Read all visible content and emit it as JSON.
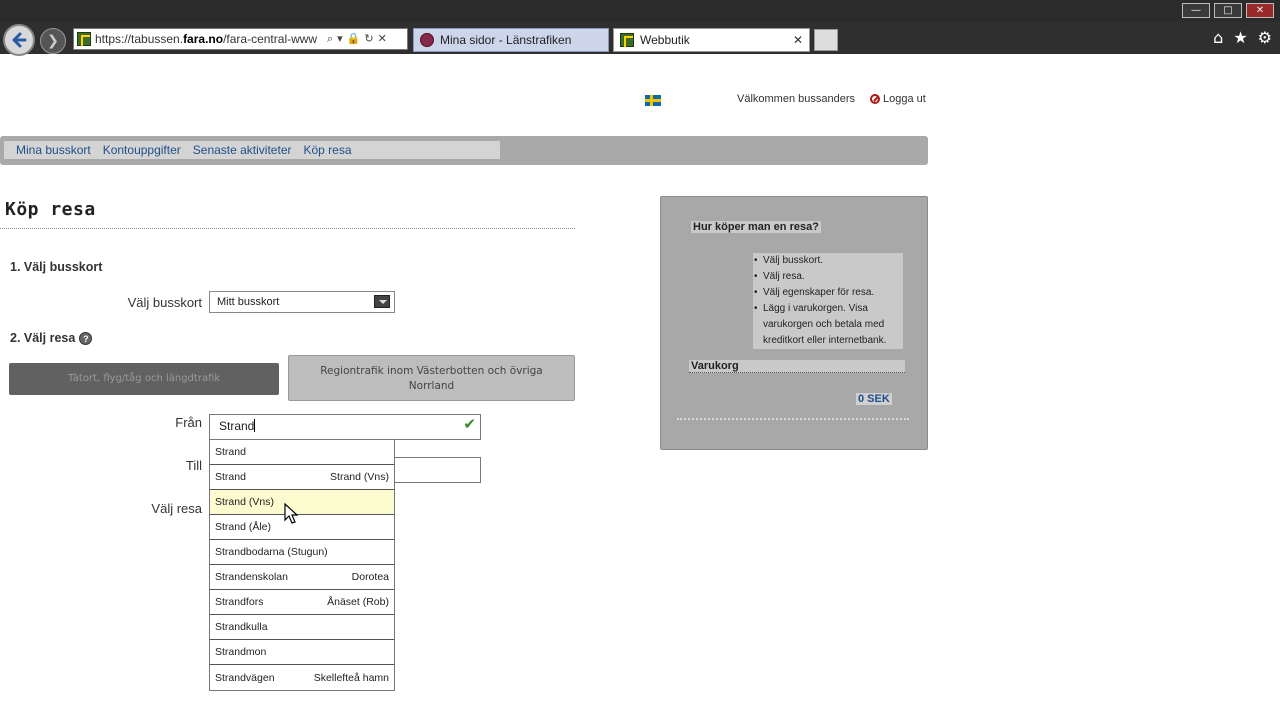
{
  "browser": {
    "url_prefix": "https://tabussen.",
    "url_domain": "fara.no",
    "url_suffix": "/fara-central-www",
    "tabs": [
      {
        "label": "Mina sidor - Länstrafiken"
      },
      {
        "label": "Webbutik"
      }
    ],
    "window_buttons": [
      "—",
      "□",
      "✕"
    ]
  },
  "header": {
    "welcome": "Välkommen bussanders",
    "logout": "Logga ut"
  },
  "nav": {
    "items": [
      "Mina busskort",
      "Kontouppgifter",
      "Senaste aktiviteter",
      "Köp resa"
    ]
  },
  "main": {
    "title": "Köp resa",
    "step1": "1. Välj busskort",
    "card_label": "Välj busskort",
    "card_value": "Mitt busskort",
    "step2": "2. Välj resa",
    "tab_a": "Tätort, flyg/tåg och längdtrafik",
    "tab_b": "Regiontrafik inom Västerbotten och övriga Norrland",
    "from_label": "Från",
    "from_value": "Strand",
    "to_label": "Till",
    "trip_label": "Välj resa"
  },
  "autocomplete": {
    "items": [
      {
        "name": "Strand",
        "area": ""
      },
      {
        "name": "Strand",
        "area": "Strand (Vns)"
      },
      {
        "name": "Strand (Vns)",
        "area": ""
      },
      {
        "name": "Strand (Åle)",
        "area": ""
      },
      {
        "name": "Strandbodarna (Stugun)",
        "area": ""
      },
      {
        "name": "Strandenskolan",
        "area": "Dorotea"
      },
      {
        "name": "Strandfors",
        "area": "Ånäset (Rob)"
      },
      {
        "name": "Strandkulla",
        "area": ""
      },
      {
        "name": "Strandmon",
        "area": ""
      },
      {
        "name": "Strandvägen",
        "area": "Skellefteå hamn"
      }
    ],
    "highlighted_index": 2
  },
  "sidebar": {
    "heading": "Hur köper man en resa?",
    "steps": [
      "Välj busskort.",
      "Välj resa.",
      "Välj egenskaper för resa.",
      "Lägg i varukorgen. Visa varukorgen och betala med kreditkort eller internetbank."
    ],
    "cart_heading": "Varukorg",
    "cart_total": "0 SEK"
  },
  "colors": {
    "link": "#1f4f8a",
    "highlight": "#fbfbcf",
    "panel": "#a8a8a8",
    "navbar": "#a9a9a9"
  }
}
